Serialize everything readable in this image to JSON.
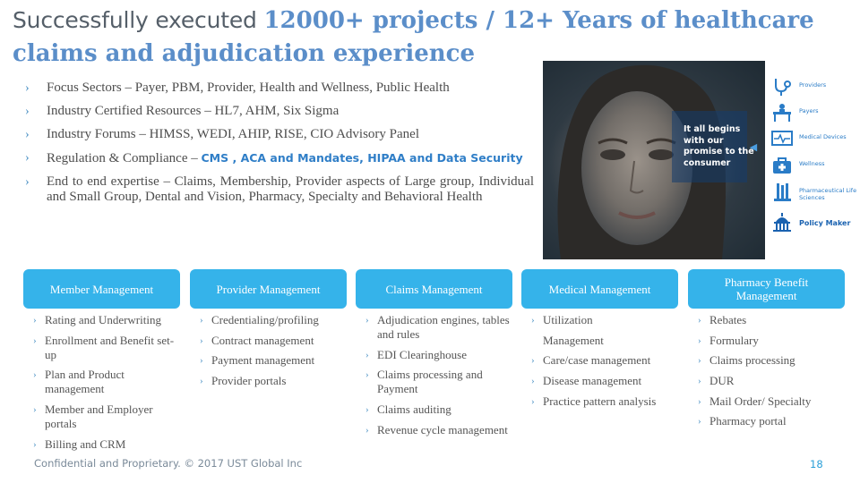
{
  "title": {
    "part1": "Successfully executed ",
    "part2": "12000+ projects / 12+ Years of healthcare claims and adjudication experience"
  },
  "bullets": [
    {
      "pre": "Focus Sectors – Payer, PBM, Provider, Health and Wellness, Public Health"
    },
    {
      "pre": "Industry Certified Resources – HL7, AHM, Six Sigma"
    },
    {
      "pre": "Industry Forums – HIMSS, WEDI, AHIP, RISE, CIO Advisory Panel"
    },
    {
      "pre": "Regulation & Compliance – ",
      "hl1": "CMS",
      "mid": " , ",
      "hl2": "ACA and Mandates, HIPAA and Data Security"
    },
    {
      "pre": "End to end expertise – Claims, Membership, Provider aspects of Large group, Individual and Small Group, Dental and Vision, Pharmacy, Specialty and Behavioral Health"
    }
  ],
  "graphic": {
    "callout": "It all begins with our promise to the consumer",
    "icons": [
      {
        "label": "Providers",
        "icon": "stethoscope-icon"
      },
      {
        "label": "Payers",
        "icon": "desk-person-icon"
      },
      {
        "label": "Medical Devices",
        "icon": "monitor-icon"
      },
      {
        "label": "Wellness",
        "icon": "first-aid-kit-icon"
      },
      {
        "label": "Pharmaceutical Life Sciences",
        "icon": "test-tube-icon"
      },
      {
        "label": "Policy Maker",
        "icon": "capitol-building-icon"
      }
    ]
  },
  "categories": [
    {
      "title": "Member Management",
      "items": [
        "Rating and Underwriting",
        "Enrollment and Benefit set-up",
        "Plan and Product management",
        "Member and Employer portals",
        "Billing and CRM"
      ]
    },
    {
      "title": "Provider Management",
      "items": [
        "Credentialing/profiling",
        "Contract management",
        "Payment management",
        "Provider portals"
      ]
    },
    {
      "title": "Claims Management",
      "items": [
        "Adjudication engines, tables and rules",
        "EDI Clearinghouse",
        "Claims processing and Payment",
        "Claims auditing",
        "Revenue cycle management"
      ]
    },
    {
      "title": "Medical Management",
      "items": [
        "Utilization",
        "Management",
        "Care/case management",
        "Disease management",
        "Practice pattern analysis"
      ]
    },
    {
      "title": "Pharmacy Benefit Management",
      "items": [
        "Rebates",
        "Formulary",
        "Claims processing",
        "DUR",
        "Mail Order/ Specialty",
        "Pharmacy portal"
      ]
    }
  ],
  "footer": "Confidential and Proprietary. © 2017 UST Global Inc",
  "page_number": "18",
  "colors": {
    "accent": "#35b3ea",
    "title_highlight": "#5b8ec9",
    "bullet_chevron": "#4a90c4"
  }
}
